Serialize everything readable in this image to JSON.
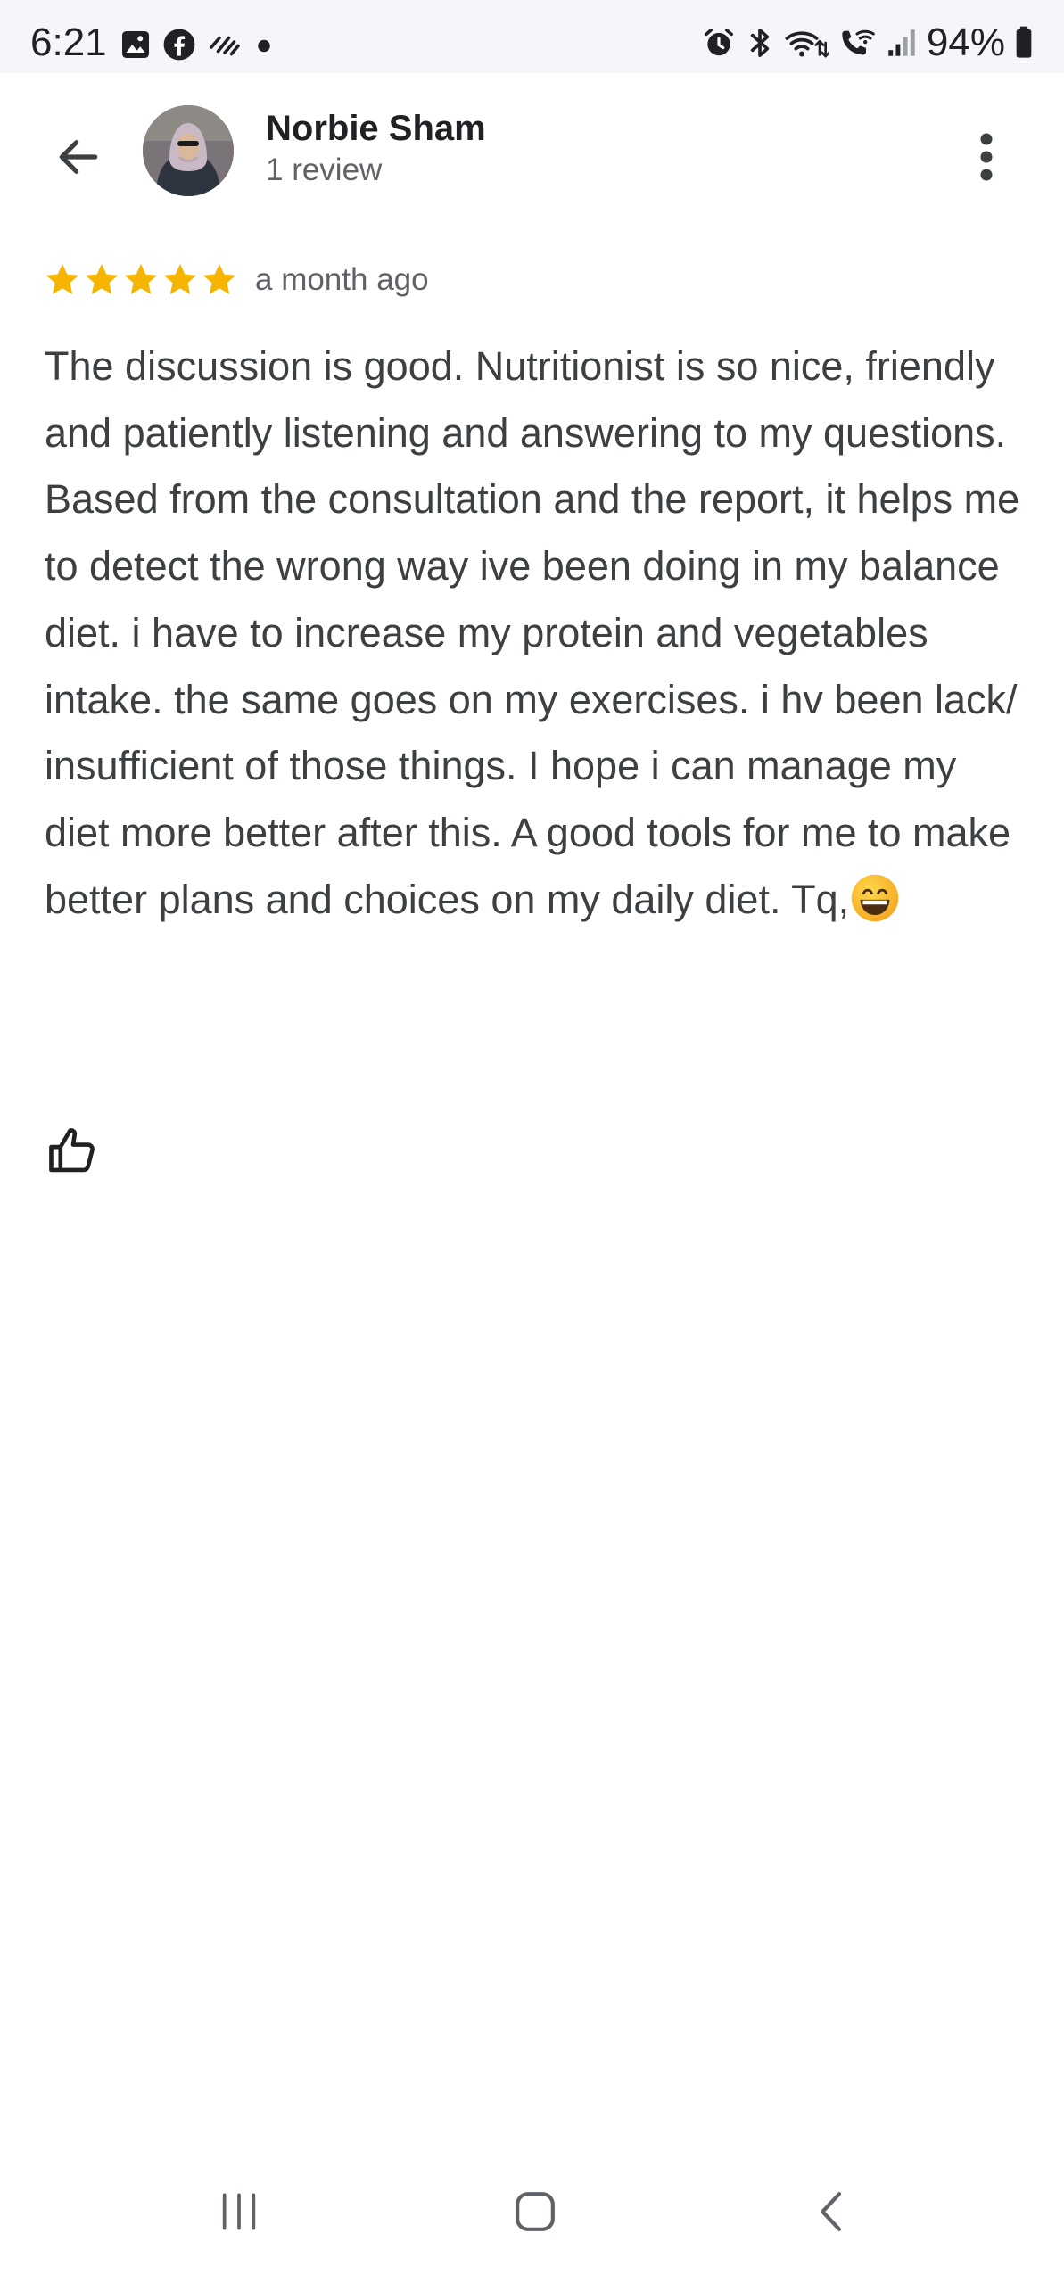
{
  "status_bar": {
    "time": "6:21",
    "battery": "94%",
    "left_icons": [
      "image-icon",
      "facebook-icon",
      "data-sync-icon",
      "dot-icon"
    ],
    "right_icons": [
      "alarm-icon",
      "bluetooth-icon",
      "wifi-icon",
      "wifi-calling-icon",
      "signal-icon",
      "battery-icon"
    ]
  },
  "header": {
    "reviewer_name": "Norbie Sham",
    "review_count": "1 review"
  },
  "review": {
    "rating": 5,
    "star_color": "#f4b400",
    "date": "a month ago",
    "text": "The discussion is good. Nutritionist is so nice, friendly and patiently listening and answering to my questions.\nBased from the consultation and the report, it helps me to detect the wrong way ive been doing in my balance diet. i have to increase my protein and vegetables intake. the same goes on my exercises. i hv been lack/ insufficient of those things. I hope i can manage my diet more better after this. A good tools for me to make better plans and choices on my daily diet. Tq,",
    "trailing_emoji": "grinning-face-emoji"
  },
  "nav_bar": {
    "buttons": [
      "recent-apps-icon",
      "home-icon",
      "back-nav-icon"
    ]
  }
}
